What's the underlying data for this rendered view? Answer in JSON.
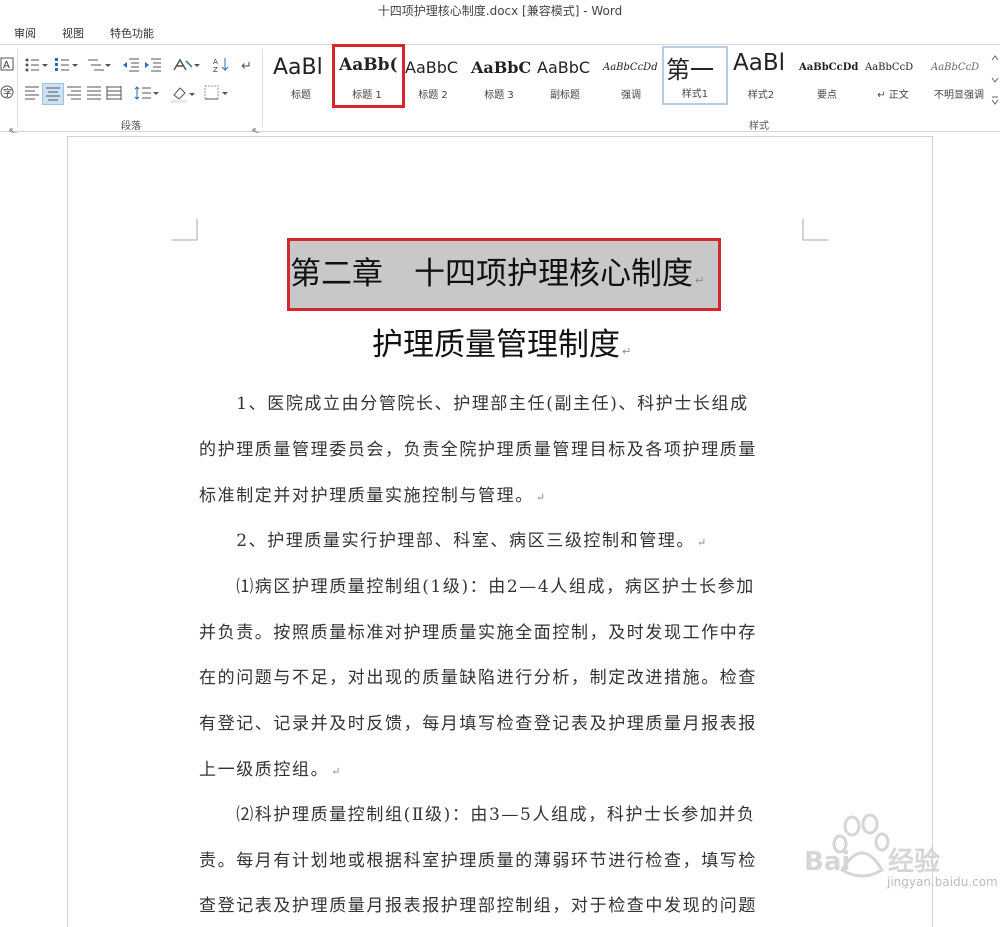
{
  "window": {
    "title": "十四项护理核心制度.docx [兼容模式] - Word"
  },
  "tabs": [
    "审阅",
    "视图",
    "特色功能"
  ],
  "ribbon": {
    "groups": {
      "paragraph": "段落",
      "styles": "样式"
    },
    "styles": [
      {
        "preview": "AaBl",
        "name": "标题"
      },
      {
        "preview": "AaBb(",
        "name": "标题 1"
      },
      {
        "preview": "AaBbC",
        "name": "标题 2"
      },
      {
        "preview": "AaBbC",
        "name": "标题 3"
      },
      {
        "preview": "AaBbC",
        "name": "副标题"
      },
      {
        "preview": "AaBbCcDd",
        "name": "强调"
      },
      {
        "preview": "第一",
        "name": "样式1"
      },
      {
        "preview": "AaBl",
        "name": "样式2"
      },
      {
        "preview": "AaBbCcDd",
        "name": "要点"
      },
      {
        "preview": "AaBbCcD",
        "name": "↵ 正文"
      },
      {
        "preview": "AaBbCcD",
        "name": "不明显强调"
      }
    ],
    "selected_style": "样式1",
    "highlighted_style": "标题 1"
  },
  "document": {
    "heading1": "第二章　十四项护理核心制度",
    "heading2": "护理质量管理制度",
    "paragraph_mark": "↵",
    "lines": [
      "　　1、医院成立由分管院长、护理部主任(副主任)、科护士长组成",
      "的护理质量管理委员会，负责全院护理质量管理目标及各项护理质量",
      "标准制定并对护理质量实施控制与管理。",
      "　　2、护理质量实行护理部、科室、病区三级控制和管理。",
      "　　⑴病区护理质量控制组(1级)：由2—4人组成，病区护士长参加",
      "并负责。按照质量标准对护理质量实施全面控制，及时发现工作中存",
      "在的问题与不足，对出现的质量缺陷进行分析，制定改进措施。检查",
      "有登记、记录并及时反馈，每月填写检查登记表及护理质量月报表报",
      "上一级质控组。",
      "　　⑵科护理质量控制组(Ⅱ级)：由3—5人组成，科护士长参加并负",
      "责。每月有计划地或根据科室护理质量的薄弱环节进行检查，填写检",
      "查登记表及护理质量月报表报护理部控制组，对于检查中发现的问题"
    ]
  },
  "watermark": {
    "text": "jingyan.baidu.com"
  }
}
